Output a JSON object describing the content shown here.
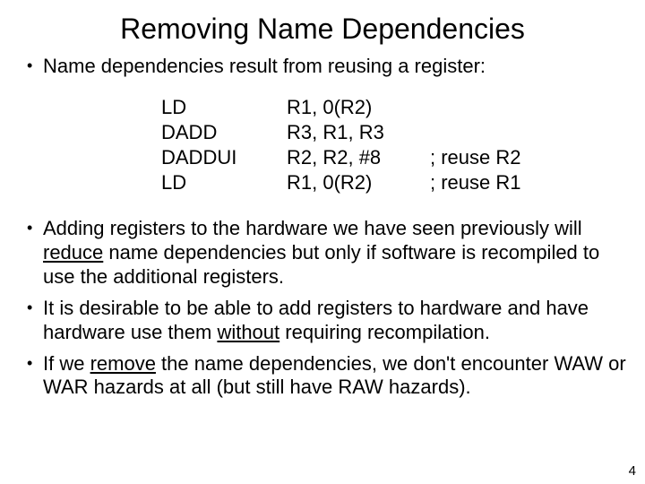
{
  "title": "Removing Name Dependencies",
  "bullet1": "Name dependencies result from reusing a register:",
  "code": {
    "rows": [
      {
        "op": "LD",
        "args": "R1, 0(R2)",
        "cmt": ""
      },
      {
        "op": "DADD",
        "args": "R3, R1, R3",
        "cmt": ""
      },
      {
        "op": "DADDUI",
        "args": "R2, R2, #8",
        "cmt": "; reuse R2"
      },
      {
        "op": "LD",
        "args": "R1, 0(R2)",
        "cmt": "; reuse R1"
      }
    ]
  },
  "bullet2": {
    "pre": "Adding registers to the hardware we have seen previously will ",
    "u": "reduce",
    "post": " name dependencies but only if software is recompiled to use the additional registers."
  },
  "bullet3": {
    "pre": "It is desirable to be able to add registers to hardware and have hardware use them ",
    "u": "without",
    "post": " requiring recompilation."
  },
  "bullet4": {
    "pre": "If we ",
    "u": "remove",
    "post": " the name dependencies, we don't encounter WAW or WAR hazards at all (but still have RAW hazards)."
  },
  "page": "4"
}
